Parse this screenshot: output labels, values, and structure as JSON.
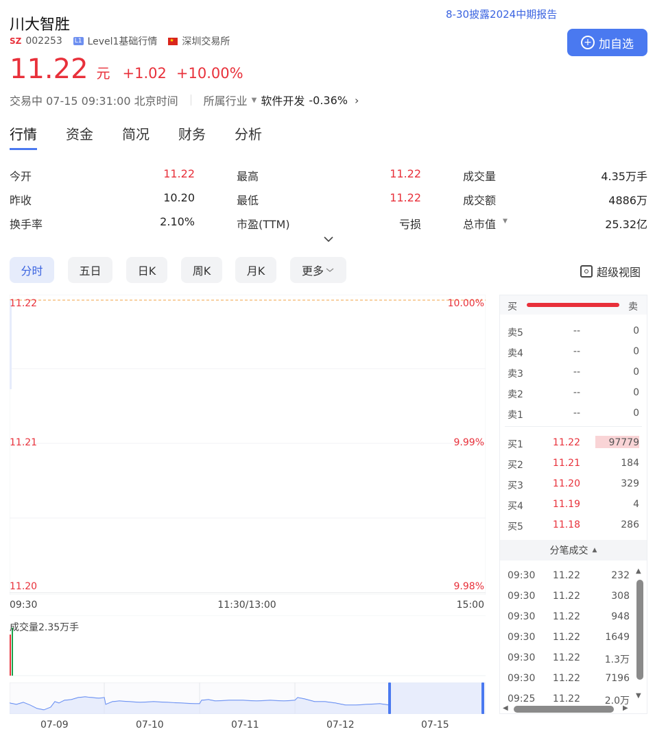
{
  "stock": {
    "name": "川大智胜",
    "exchange_tag": "SZ",
    "code": "002253",
    "level_badge": "L1",
    "level_text": "Level1基础行情",
    "exchange": "深圳交易所"
  },
  "notice": "8-30披露2024中期报告",
  "add_button": "加自选",
  "quote": {
    "price": "11.22",
    "unit": "元",
    "change": "+1.02",
    "change_pct": "+10.00%"
  },
  "status": {
    "text": "交易中 07-15 09:31:00 北京时间",
    "industry_label": "所属行业",
    "industry": "软件开发",
    "industry_change": "-0.36%"
  },
  "tabs": [
    "行情",
    "资金",
    "简况",
    "财务",
    "分析"
  ],
  "stats": [
    [
      {
        "label": "今开",
        "value": "11.22",
        "color": "#e8303a"
      },
      {
        "label": "最高",
        "value": "11.22",
        "color": "#e8303a"
      },
      {
        "label": "成交量",
        "value": "4.35万手",
        "color": "#222222"
      }
    ],
    [
      {
        "label": "昨收",
        "value": "10.20",
        "color": "#222222"
      },
      {
        "label": "最低",
        "value": "11.22",
        "color": "#e8303a"
      },
      {
        "label": "成交额",
        "value": "4886万",
        "color": "#222222"
      }
    ],
    [
      {
        "label": "换手率",
        "value": "2.10%",
        "color": "#222222"
      },
      {
        "label": "市盈(TTM)",
        "value": "亏损",
        "color": "#222222"
      },
      {
        "label": "总市值",
        "value": "25.32亿",
        "color": "#222222"
      }
    ]
  ],
  "periods": [
    "分时",
    "五日",
    "日K",
    "周K",
    "月K",
    "更多"
  ],
  "super_view": "超级视图",
  "chart": {
    "price_labels": [
      "11.22",
      "11.21",
      "11.20"
    ],
    "pct_labels": [
      "10.00%",
      "9.99%",
      "9.98%"
    ],
    "time_labels": [
      "09:30",
      "11:30/13:00",
      "15:00"
    ],
    "volume_label": "成交量2.35万手",
    "nav_dates": [
      "07-09",
      "07-10",
      "07-11",
      "07-12",
      "07-15"
    ]
  },
  "orderbook": {
    "sell_label": "买",
    "buy_label": "卖",
    "asks": [
      {
        "label": "卖5",
        "price": "--",
        "vol": "0"
      },
      {
        "label": "卖4",
        "price": "--",
        "vol": "0"
      },
      {
        "label": "卖3",
        "price": "--",
        "vol": "0"
      },
      {
        "label": "卖2",
        "price": "--",
        "vol": "0"
      },
      {
        "label": "卖1",
        "price": "--",
        "vol": "0"
      }
    ],
    "bids": [
      {
        "label": "买1",
        "price": "11.22",
        "vol": "97779"
      },
      {
        "label": "买2",
        "price": "11.21",
        "vol": "184"
      },
      {
        "label": "买3",
        "price": "11.20",
        "vol": "329"
      },
      {
        "label": "买4",
        "price": "11.19",
        "vol": "4"
      },
      {
        "label": "买5",
        "price": "11.18",
        "vol": "286"
      }
    ]
  },
  "ticks_header": "分笔成交",
  "ticks": [
    {
      "time": "09:30",
      "price": "11.22",
      "vol": "232"
    },
    {
      "time": "09:30",
      "price": "11.22",
      "vol": "308"
    },
    {
      "time": "09:30",
      "price": "11.22",
      "vol": "948"
    },
    {
      "time": "09:30",
      "price": "11.22",
      "vol": "1649"
    },
    {
      "time": "09:30",
      "price": "11.22",
      "vol": "1.3万"
    },
    {
      "time": "09:30",
      "price": "11.22",
      "vol": "7196"
    },
    {
      "time": "09:25",
      "price": "11.22",
      "vol": "2.0万"
    }
  ],
  "colors": {
    "up": "#e8303a",
    "accent": "#4a79f0",
    "volume_green": "#1aa34a"
  }
}
